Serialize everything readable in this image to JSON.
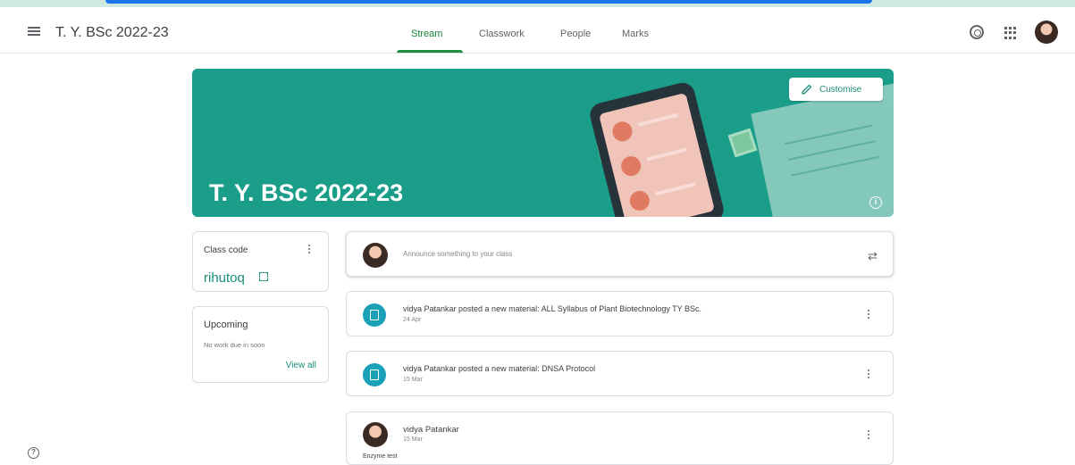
{
  "header": {
    "class_title": "T. Y. BSc 2022-23",
    "tabs": [
      {
        "label": "Stream",
        "active": true
      },
      {
        "label": "Classwork",
        "active": false
      },
      {
        "label": "People",
        "active": false
      },
      {
        "label": "Marks",
        "active": false
      }
    ],
    "icons": [
      "menu-icon",
      "settings-icon",
      "apps-icon",
      "account-avatar"
    ]
  },
  "banner": {
    "title": "T. Y. BSc 2022-23",
    "customise_label": "Customise",
    "color": "#1a9e8a"
  },
  "class_code": {
    "label": "Class code",
    "value": "rihutoq"
  },
  "upcoming": {
    "title": "Upcoming",
    "empty_text": "No work due in soon",
    "link": "View all"
  },
  "announce": {
    "placeholder": "Announce something to your class"
  },
  "posts": [
    {
      "title": "vidya Patankar posted a new material: ALL Syllabus of Plant Biotechnology TY BSc.",
      "date": "24 Apr"
    },
    {
      "title": "vidya Patankar posted a new material: DNSA Protocol",
      "date": "15 Mar"
    }
  ],
  "post3": {
    "author": "vidya Patankar",
    "date": "15 Mar",
    "body": "Enzyme test"
  },
  "colors": {
    "accent": "#1a8f7a",
    "active_tab": "#188038",
    "post_icon": "#1aa1b8"
  }
}
